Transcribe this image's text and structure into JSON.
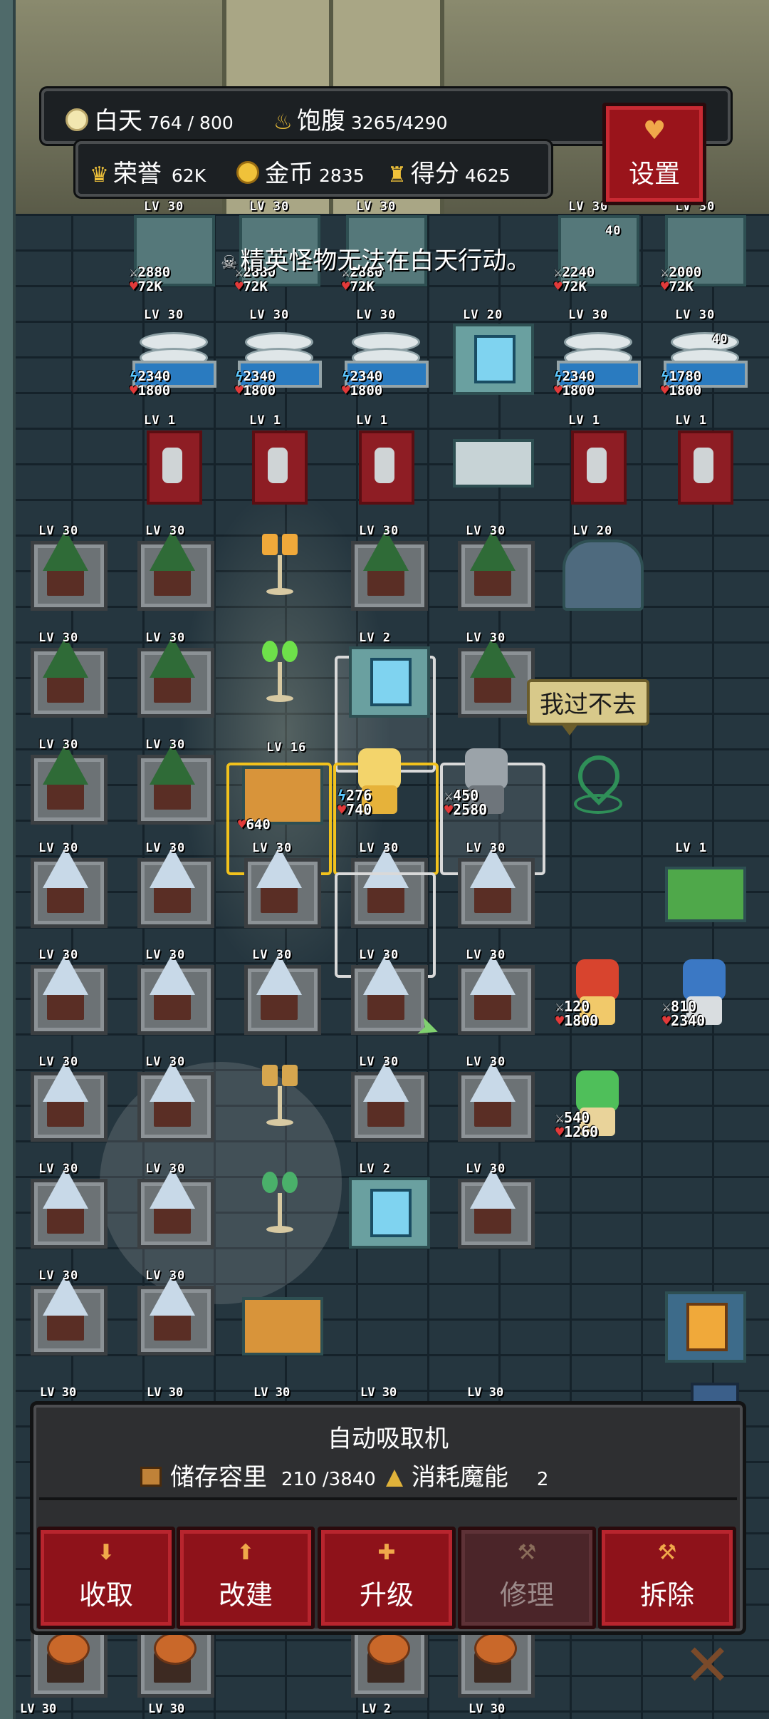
{
  "hud": {
    "daytime_label": "白天",
    "daytime_value": "764 / 800",
    "satiety_label": "饱腹",
    "satiety_value": "3265/4290",
    "honor_label": "荣誉",
    "honor_value": "62K",
    "gold_label": "金币",
    "gold_value": "2835",
    "score_label": "得分",
    "score_value": "4625",
    "settings_label": "设置"
  },
  "toast": "精英怪物无法在白天行动。",
  "speech_bubble": "我过不去",
  "levels": {
    "lv30": "LV 30",
    "lv20": "LV 20",
    "lv16": "LV 16",
    "lv2": "LV 2",
    "lv1": "LV 1"
  },
  "tile_stats": {
    "t1_atk": "2880",
    "t1_hp": "72K",
    "t2_atk": "2880",
    "t2_hp": "72K",
    "t3_atk": "2880",
    "t3_hp": "72K",
    "t4_atk": "2240",
    "t4_hp": "72K",
    "t4_extra": "40",
    "t5_atk": "2000",
    "t5_hp": "72K",
    "f1_mp": "2340",
    "f1_hp": "1800",
    "f2_mp": "2340",
    "f2_hp": "1800",
    "f3_mp": "2340",
    "f3_hp": "1800",
    "f4_mp": "2340",
    "f4_hp": "1800",
    "f5_mp": "1780",
    "f5_hp": "1800",
    "f5_extra": "40",
    "chest_hp": "640",
    "hero1_atk": "276",
    "hero1_hp": "740",
    "hero2_atk": "450",
    "hero2_hp": "2580",
    "hero3_atk": "120",
    "hero3_hp": "1800",
    "hero4_atk": "810",
    "hero4_hp": "2340",
    "hero5_atk": "540",
    "hero5_hp": "1260"
  },
  "panel": {
    "title": "自动吸取机",
    "storage_label": "储存容里",
    "storage_value": "210 /3840",
    "consume_label": "消耗魔能",
    "consume_value": "2"
  },
  "actions": [
    {
      "label": "收取",
      "icon": "arrow-down-icon",
      "enabled": true
    },
    {
      "label": "改建",
      "icon": "arrow-up-icon",
      "enabled": true
    },
    {
      "label": "升级",
      "icon": "plus-icon",
      "enabled": true
    },
    {
      "label": "修理",
      "icon": "hammer-icon",
      "enabled": false
    },
    {
      "label": "拆除",
      "icon": "hammer-icon",
      "enabled": true
    }
  ],
  "colors": {
    "highlight_gold": "#f2c21c",
    "button_red": "#8e121a",
    "hp_red": "#e23a3a",
    "mana_blue": "#5ac8ff"
  }
}
